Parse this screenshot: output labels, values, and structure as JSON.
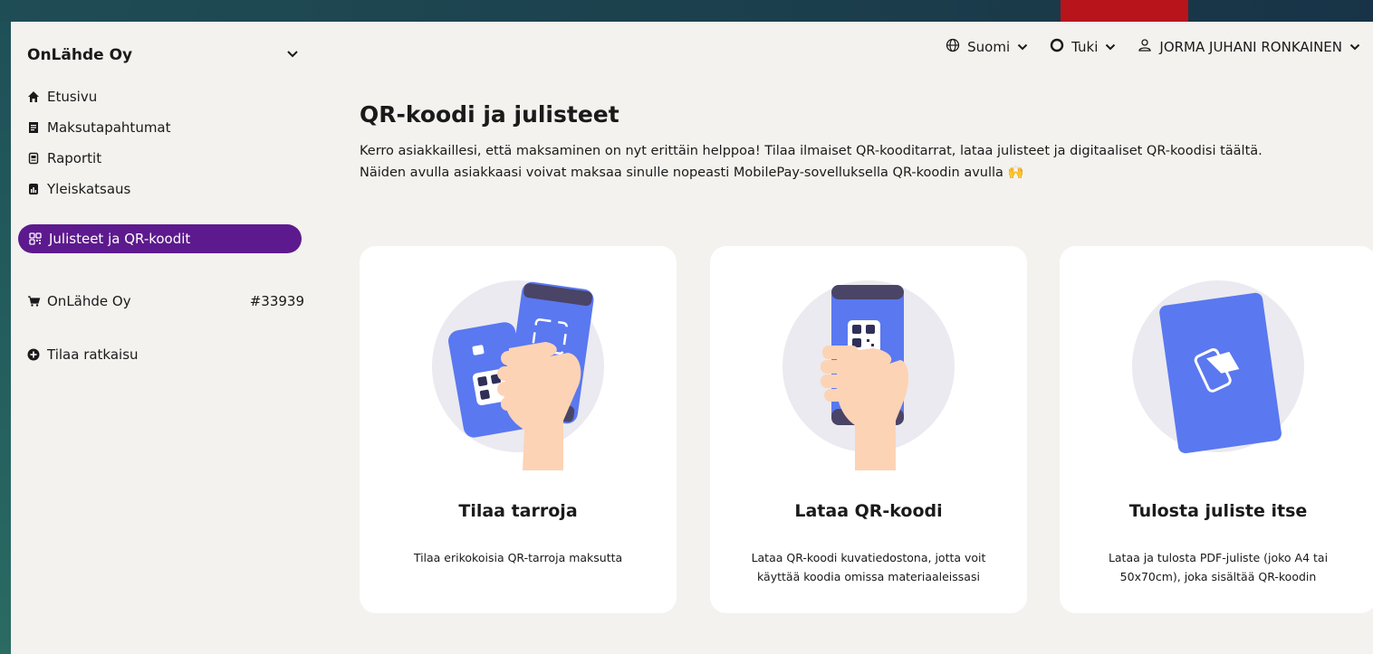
{
  "sidebar": {
    "company": "OnLähde Oy",
    "nav": [
      {
        "label": "Etusivu",
        "icon": "home-icon"
      },
      {
        "label": "Maksutapahtumat",
        "icon": "receipt-icon"
      },
      {
        "label": "Raportit",
        "icon": "report-icon"
      },
      {
        "label": "Yleiskatsaus",
        "icon": "chart-icon"
      }
    ],
    "active": {
      "label": "Julisteet ja QR-koodit",
      "icon": "qr-icon"
    },
    "shop": {
      "name": "OnLähde Oy",
      "id": "#33939",
      "icon": "cart-icon"
    },
    "order": {
      "label": "Tilaa ratkaisu",
      "icon": "plus-circle-icon"
    }
  },
  "header": {
    "language": "Suomi",
    "support": "Tuki",
    "user": "JORMA JUHANI RONKAINEN"
  },
  "main": {
    "title": "QR-koodi ja julisteet",
    "intro_line1": "Kerro asiakkaillesi, että maksaminen on nyt erittäin helppoa! Tilaa ilmaiset QR-kooditarrat, lataa julisteet ja digitaaliset QR-koodisi täältä.",
    "intro_line2": "Näiden avulla asiakkaasi voivat maksaa sinulle nopeasti MobilePay-sovelluksella QR-koodin avulla 🙌"
  },
  "cards": [
    {
      "title": "Tilaa tarroja",
      "desc": "Tilaa erikokoisia QR-tarroja maksutta"
    },
    {
      "title": "Lataa QR-koodi",
      "desc": "Lataa QR-koodi kuvatiedostona, jotta voit käyttää koodia omissa materiaaleissasi"
    },
    {
      "title": "Tulosta juliste itse",
      "desc": "Lataa ja tulosta PDF-juliste (joko A4 tai 50x70cm), joka sisältää QR-koodin"
    }
  ],
  "colors": {
    "accent": "#5d1a8e",
    "brand_blue": "#5a78f0",
    "skin": "#fdd3b5",
    "circle": "#ebeaf0"
  }
}
